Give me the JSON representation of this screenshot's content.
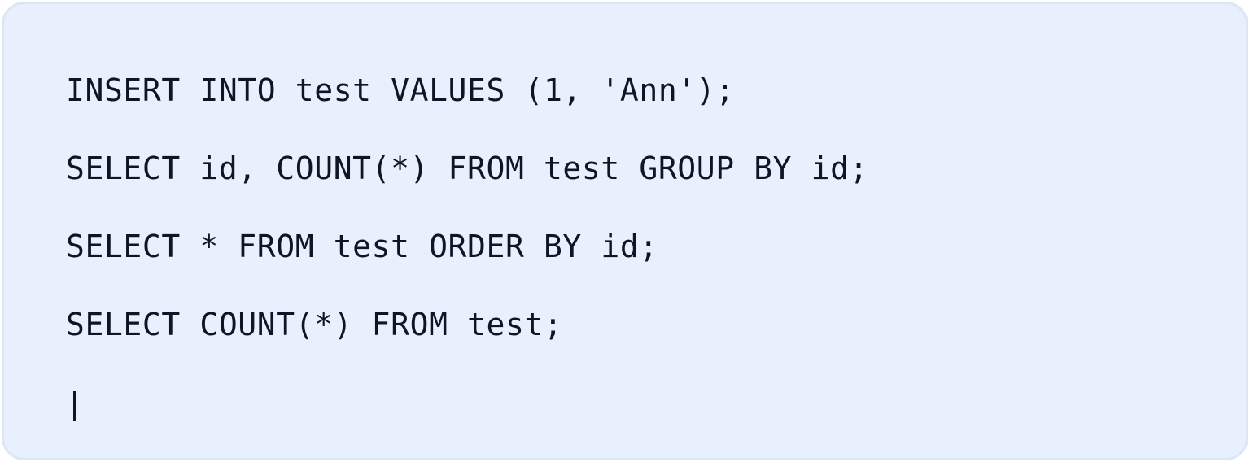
{
  "editor": {
    "lines": [
      "INSERT INTO test VALUES (1, 'Ann');",
      "SELECT id, COUNT(*) FROM test GROUP BY id;",
      "SELECT * FROM test ORDER BY id;",
      "SELECT COUNT(*) FROM test;"
    ]
  },
  "colors": {
    "panel_background": "#e8f0fd",
    "panel_border": "#dde6f5",
    "text": "#0f1525"
  }
}
